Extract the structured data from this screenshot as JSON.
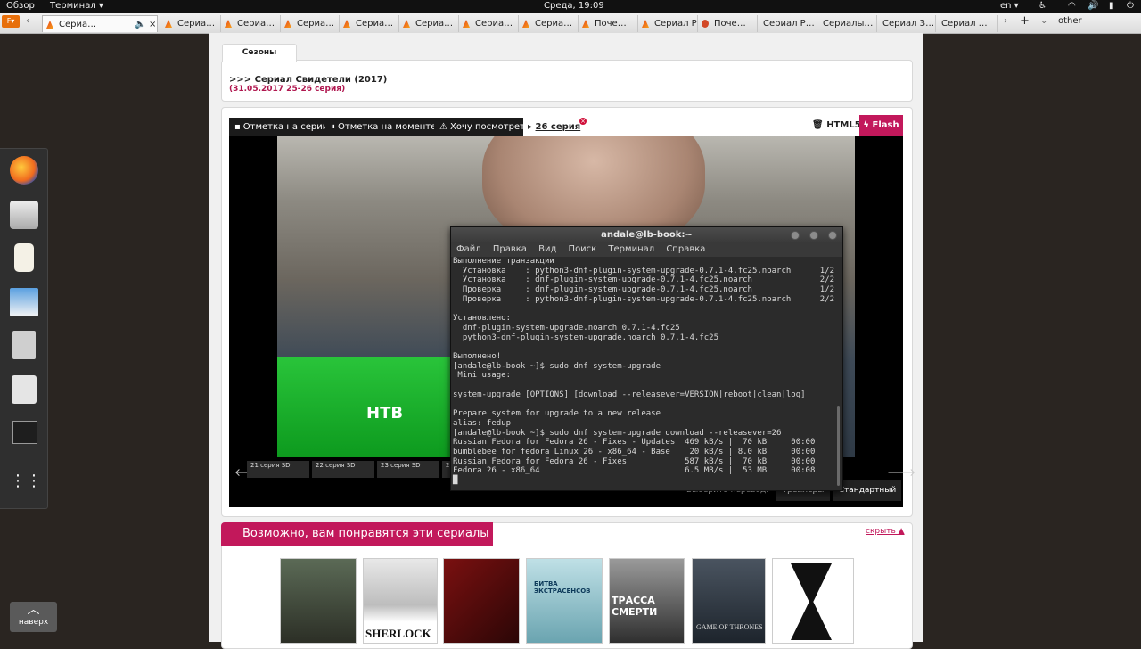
{
  "topbar": {
    "overview": "Обзор",
    "terminal_menu": "Терминал ▾",
    "clock": "Среда, 19:09",
    "lang": "en ▾"
  },
  "browser": {
    "menu_label": "F▾",
    "tabs": [
      "Сериа…",
      "Сериа…",
      "Сериа…",
      "Сериа…",
      "Сериа…",
      "Сериа…",
      "Сериа…",
      "Сериа…",
      "Поче…",
      "Сериал Р…",
      "Сериалы…",
      "Сериал З…",
      "Сериал …"
    ],
    "new_tab": "+",
    "other": "other"
  },
  "seasons": {
    "tab": "Сезоны",
    "title": ">>> Сериал Свидетели (2017)",
    "subtitle": "(31.05.2017 25-26 серия)"
  },
  "player": {
    "tabs": [
      "Отметка на серии",
      "Отметка на моменте",
      "Хочу посмотреть"
    ],
    "episode": "26 серия",
    "html5": "HTML5",
    "flash": "Flash",
    "thumbs": [
      "21 серия SD",
      "22 серия SD",
      "23 серия SD",
      "2"
    ],
    "translation_label": "Выберите перевод:",
    "translations": [
      "Трейлеры",
      "Стандартный"
    ]
  },
  "terminal": {
    "title": "andale@lb-book:~",
    "menu": [
      "Файл",
      "Правка",
      "Вид",
      "Поиск",
      "Терминал",
      "Справка"
    ],
    "output": "Выполнение транзакции\n  Установка    : python3-dnf-plugin-system-upgrade-0.7.1-4.fc25.noarch      1/2\n  Установка    : dnf-plugin-system-upgrade-0.7.1-4.fc25.noarch              2/2\n  Проверка     : dnf-plugin-system-upgrade-0.7.1-4.fc25.noarch              1/2\n  Проверка     : python3-dnf-plugin-system-upgrade-0.7.1-4.fc25.noarch      2/2\n\nУстановлено:\n  dnf-plugin-system-upgrade.noarch 0.7.1-4.fc25\n  python3-dnf-plugin-system-upgrade.noarch 0.7.1-4.fc25\n\nВыполнено!\n[andale@lb-book ~]$ sudo dnf system-upgrade\n Mini usage:\n\nsystem-upgrade [OPTIONS] [download --releasever=VERSION|reboot|clean|log]\n\nPrepare system for upgrade to a new release\nalias: fedup\n[andale@lb-book ~]$ sudo dnf system-upgrade download --releasever=26\nRussian Fedora for Fedora 26 - Fixes - Updates  469 kB/s |  70 kB     00:00\nbumblebee for fedora Linux 26 - x86_64 - Base    20 kB/s | 8.0 kB     00:00\nRussian Fedora for Fedora 26 - Fixes            587 kB/s |  70 kB     00:00\nFedora 26 - x86_64                              6.5 MB/s |  53 MB     00:08\n█"
  },
  "recommend": {
    "title": "Возможно, вам понравятся эти сериалы",
    "hide": "скрыть ▲",
    "posters": [
      "",
      "SHERLOCK",
      "",
      "БИТВА ЭКСТРАСЕНСОВ",
      "ТРАССА СМЕРТИ",
      "GAME OF THRONES",
      ""
    ]
  },
  "scroll_top": {
    "label": "наверх"
  },
  "colors": {
    "accent": "#c2185b",
    "terminal_bg": "#2b2b2b"
  }
}
